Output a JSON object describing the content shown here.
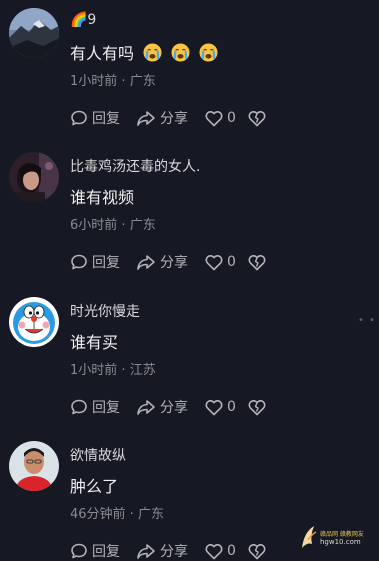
{
  "comments": [
    {
      "username": "🌈9",
      "text": "有人有吗",
      "emojis": [
        "crying-face",
        "crying-face",
        "crying-face"
      ],
      "time": "1小时前",
      "location": "广东",
      "avatar": "avatar-mountain-sky",
      "reply_label": "回复",
      "share_label": "分享",
      "like_count": "0"
    },
    {
      "username": "比毒鸡汤还毒的女人.",
      "text": "谁有视频",
      "time": "6小时前",
      "location": "广东",
      "avatar": "avatar-dark-selfie",
      "reply_label": "回复",
      "share_label": "分享",
      "like_count": "0"
    },
    {
      "username": "时光你慢走",
      "text": "谁有买",
      "time": "1小时前",
      "location": "江苏",
      "avatar": "avatar-doraemon",
      "reply_label": "回复",
      "share_label": "分享",
      "like_count": "0"
    },
    {
      "username": "欲情故纵",
      "text": "肿么了",
      "time": "46分钟前",
      "location": "广东",
      "avatar": "avatar-man-red-shirt",
      "reply_label": "回复",
      "share_label": "分享",
      "like_count": "0"
    }
  ],
  "meta_separator": " · ",
  "more_indicator": "• •",
  "watermark": {
    "line1": "赣品网  赣教网友",
    "line2": "hgw10.com"
  },
  "colors": {
    "background": "#161823",
    "text_primary": "#f1f1f2",
    "text_secondary": "#8a8b91"
  }
}
